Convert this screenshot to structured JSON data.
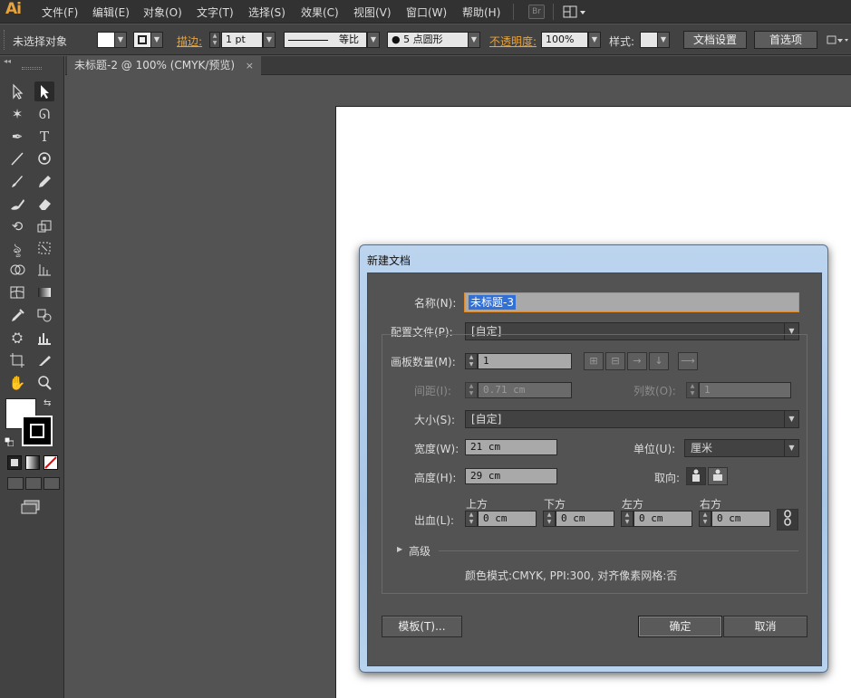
{
  "app": {
    "logo": "Ai"
  },
  "menu": [
    "文件(F)",
    "编辑(E)",
    "对象(O)",
    "文字(T)",
    "选择(S)",
    "效果(C)",
    "视图(V)",
    "窗口(W)",
    "帮助(H)"
  ],
  "menubar_extra": {
    "br_label": "Br"
  },
  "control_bar": {
    "selection": "未选择对象",
    "stroke_label": "描边:",
    "stroke_value": "1 pt",
    "stroke_profile": "等比",
    "brush": "5 点圆形",
    "opacity_label": "不透明度:",
    "opacity_value": "100%",
    "style_label": "样式:",
    "doc_setup": "文档设置",
    "preferences": "首选项"
  },
  "document_tab": {
    "title": "未标题-2 @ 100% (CMYK/预览)",
    "close": "×"
  },
  "toolbar": {
    "collapse": "◂◂"
  },
  "dialog": {
    "title": "新建文档",
    "name_label": "名称(N):",
    "name_value": "未标题-3",
    "profile_label": "配置文件(P):",
    "profile_value": "[自定]",
    "artboards_label": "画板数量(M):",
    "artboards_value": "1",
    "spacing_label": "间距(I):",
    "spacing_value": "0.71 cm",
    "columns_label": "列数(O):",
    "columns_value": "1",
    "size_label": "大小(S):",
    "size_value": "[自定]",
    "width_label": "宽度(W):",
    "width_value": "21 cm",
    "units_label": "单位(U):",
    "units_value": "厘米",
    "height_label": "高度(H):",
    "height_value": "29 cm",
    "orientation_label": "取向:",
    "bleed_label": "出血(L):",
    "bleed_top_label": "上方",
    "bleed_top": "0 cm",
    "bleed_bottom_label": "下方",
    "bleed_bottom": "0 cm",
    "bleed_left_label": "左方",
    "bleed_left": "0 cm",
    "bleed_right_label": "右方",
    "bleed_right": "0 cm",
    "advanced_label": "高级",
    "summary": "颜色模式:CMYK, PPI:300, 对齐像素网格:否",
    "template_button": "模板(T)...",
    "ok_button": "确定",
    "cancel_button": "取消"
  },
  "colors": {
    "accent": "#e8a33c",
    "panel": "#424242",
    "canvas": "#535353",
    "dialog_frame": "#a9c7e8"
  }
}
